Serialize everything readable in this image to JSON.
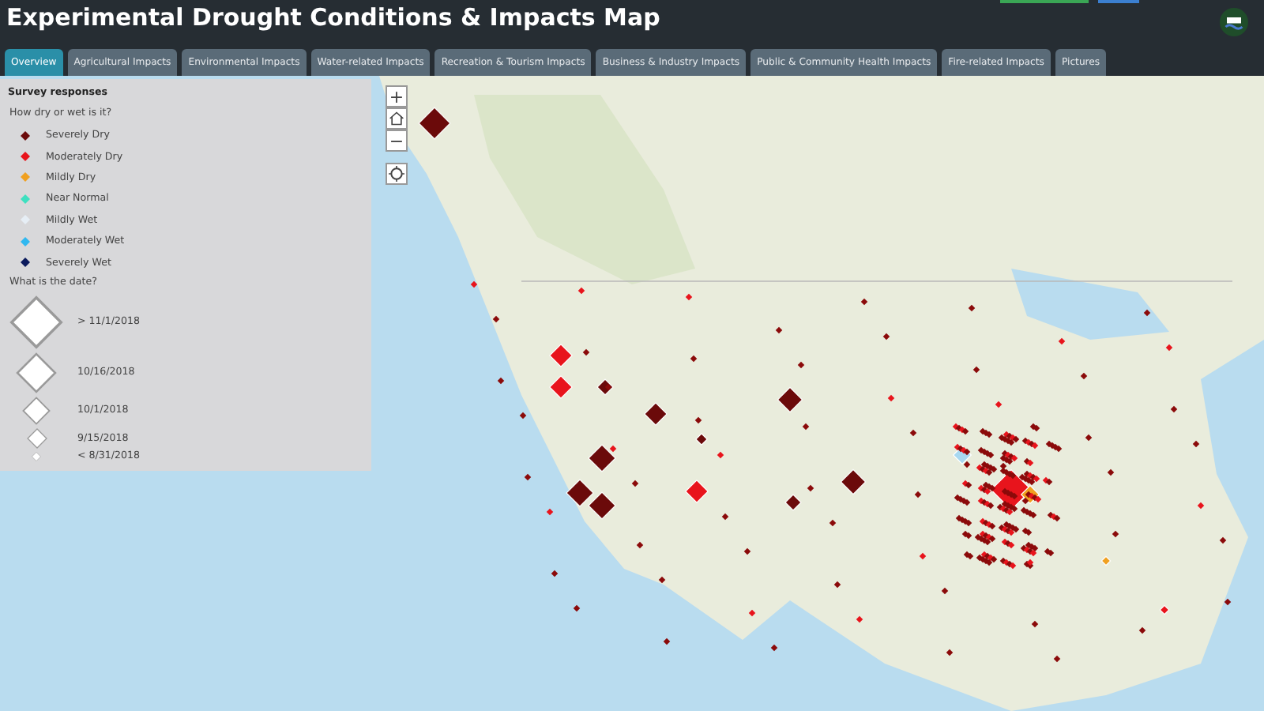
{
  "header": {
    "title": "Experimental Drought Conditions & Impacts Map"
  },
  "tabs": [
    {
      "label": "Overview",
      "selected": true
    },
    {
      "label": "Agricultural Impacts",
      "selected": false
    },
    {
      "label": "Environmental Impacts",
      "selected": false
    },
    {
      "label": "Water-related Impacts",
      "selected": false
    },
    {
      "label": "Recreation & Tourism Impacts",
      "selected": false
    },
    {
      "label": "Business & Industry Impacts",
      "selected": false
    },
    {
      "label": "Public & Community Health Impacts",
      "selected": false
    },
    {
      "label": "Fire-related Impacts",
      "selected": false
    },
    {
      "label": "Pictures",
      "selected": false
    }
  ],
  "legend": {
    "title": "Survey responses",
    "condition_heading": "How dry or wet is it?",
    "conditions": [
      {
        "label": "Severely Dry",
        "color": "#6b0a0a"
      },
      {
        "label": "Moderately Dry",
        "color": "#e8141c"
      },
      {
        "label": "Mildly Dry",
        "color": "#f0a020"
      },
      {
        "label": "Near Normal",
        "color": "#3ee0c0"
      },
      {
        "label": "Mildly Wet",
        "color": "#e6eef5"
      },
      {
        "label": "Moderately Wet",
        "color": "#30b8f0"
      },
      {
        "label": "Severely Wet",
        "color": "#0b1a5c"
      }
    ],
    "date_heading": "What is the date?",
    "dates": [
      {
        "label": "> 11/1/2018"
      },
      {
        "label": "10/16/2018"
      },
      {
        "label": "10/1/2018"
      },
      {
        "label": "9/15/2018"
      },
      {
        "label": "< 8/31/2018"
      }
    ]
  },
  "map_controls": [
    {
      "kind": "zoom-in",
      "label": "+"
    },
    {
      "kind": "home"
    },
    {
      "kind": "zoom-out",
      "label": "−"
    },
    {
      "kind": "locate"
    }
  ]
}
